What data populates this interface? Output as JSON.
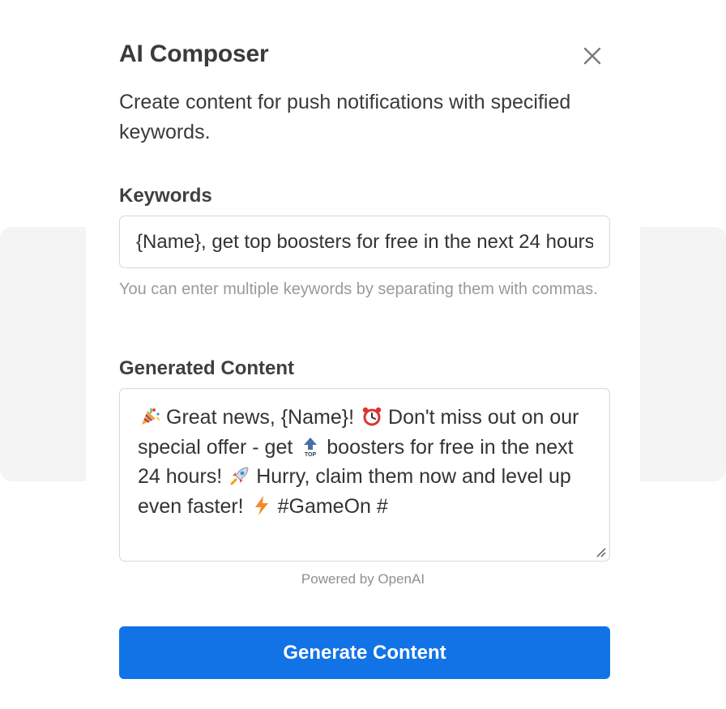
{
  "dialog": {
    "title": "AI Composer",
    "description": "Create content for push notifications with specified keywords.",
    "close_icon": "close-icon"
  },
  "keywords": {
    "label": "Keywords",
    "value": "{Name}, get top boosters for free in the next 24 hours",
    "hint": "You can enter multiple keywords by separating them with commas."
  },
  "generated": {
    "label": "Generated Content",
    "parts": {
      "p1": "Great news, {Name}!",
      "p2": "Don't miss out on our special offer - get",
      "p3": "boosters for free in the next 24 hours!",
      "p4": "Hurry, claim them now and level up even faster!",
      "p5": "#GameOn #"
    },
    "emoji_icons": [
      "party-popper-icon",
      "alarm-clock-icon",
      "top-arrow-icon",
      "rocket-icon",
      "lightning-icon"
    ]
  },
  "footer": {
    "powered_by": "Powered by OpenAI",
    "button_label": "Generate Content"
  },
  "colors": {
    "accent": "#1273e6",
    "backdrop": "#f4f4f5",
    "border": "#d8d8d8",
    "hint_text": "#9a9a9a"
  }
}
